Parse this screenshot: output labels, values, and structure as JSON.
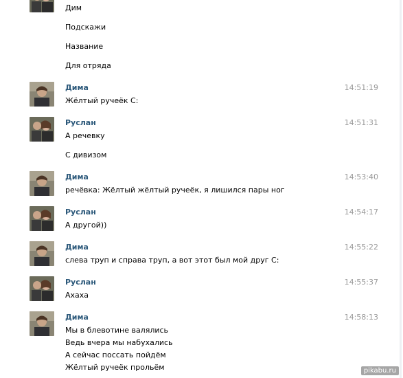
{
  "messages": [
    {
      "author": "",
      "time": "",
      "avatar": "ruslan",
      "lines": [
        "Дим",
        "Подскажи",
        "Название",
        "Для отряда"
      ]
    },
    {
      "author": "Дима",
      "time": "14:51:19",
      "avatar": "dima",
      "lines": [
        "Жёлтый ручеёк С:"
      ]
    },
    {
      "author": "Руслан",
      "time": "14:51:31",
      "avatar": "ruslan",
      "lines": [
        "А речевку",
        "С дивизом"
      ]
    },
    {
      "author": "Дима",
      "time": "14:53:40",
      "avatar": "dima",
      "lines": [
        "речёвка: Жёлтый жёлтый ручеёк, я лишился пары ног"
      ]
    },
    {
      "author": "Руслан",
      "time": "14:54:17",
      "avatar": "ruslan",
      "lines": [
        "А другой))"
      ]
    },
    {
      "author": "Дима",
      "time": "14:55:22",
      "avatar": "dima",
      "lines": [
        "слева труп и справа труп, а вот этот был мой друг С:"
      ]
    },
    {
      "author": "Руслан",
      "time": "14:55:37",
      "avatar": "ruslan",
      "lines": [
        "Ахаха"
      ]
    },
    {
      "author": "Дима",
      "time": "14:58:13",
      "avatar": "dima",
      "lines": [
        "Мы в блевотине валялись",
        "Ведь вчера мы набухались",
        "А сейчас поссать пойдём",
        "Жёлтый ручеёк прольём"
      ]
    }
  ],
  "watermark": "pikabu.ru",
  "colors": {
    "author": "#2b587a",
    "time": "#999999",
    "text": "#000000"
  }
}
